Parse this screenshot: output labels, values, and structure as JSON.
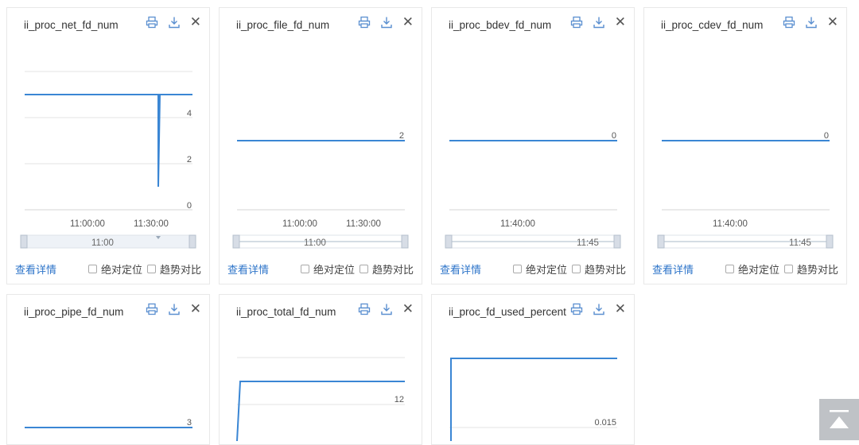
{
  "footer": {
    "detail_label": "查看详情",
    "absolute_position_label": "绝对定位",
    "trend_compare_label": "趋势对比"
  },
  "icons": {
    "print": "print-icon",
    "download": "download-icon",
    "close": "close-icon",
    "scroll_top": "arrow-up-icon"
  },
  "colors": {
    "series": "#3a86d4",
    "grid": "#e3e3e3",
    "link": "#2d74c9"
  },
  "panels": [
    {
      "title": "ii_proc_net_fd_num",
      "chart_data": {
        "type": "line",
        "yticks": [
          "4",
          "2",
          "0"
        ],
        "xticks": [
          "11:00:00",
          "11:30:00"
        ],
        "range_label": "11:00",
        "series": [
          {
            "values": [
              5,
              5,
              5,
              1,
              5,
              5
            ]
          }
        ],
        "note": "constant at 5 with a single dip to about 1 near 11:31"
      }
    },
    {
      "title": "ii_proc_file_fd_num",
      "chart_data": {
        "type": "line",
        "yticks": [
          "2"
        ],
        "xticks": [
          "11:00:00",
          "11:30:00"
        ],
        "range_label": "11:00",
        "series": [
          {
            "values": [
              2,
              2
            ]
          }
        ]
      }
    },
    {
      "title": "ii_proc_bdev_fd_num",
      "chart_data": {
        "type": "line",
        "yticks": [
          "0"
        ],
        "xticks": [
          "11:40:00"
        ],
        "range_label": "11:45",
        "series": [
          {
            "values": [
              0,
              0
            ]
          }
        ]
      }
    },
    {
      "title": "ii_proc_cdev_fd_num",
      "chart_data": {
        "type": "line",
        "yticks": [
          "0"
        ],
        "xticks": [
          "11:40:00"
        ],
        "range_label": "11:45",
        "series": [
          {
            "values": [
              0,
              0
            ]
          }
        ]
      }
    },
    {
      "title": "ii_proc_pipe_fd_num",
      "chart_data": {
        "type": "line",
        "yticks": [
          "3"
        ],
        "series": [
          {
            "values": [
              3,
              3
            ]
          }
        ]
      }
    },
    {
      "title": "ii_proc_total_fd_num",
      "chart_data": {
        "type": "line",
        "yticks": [
          "12"
        ],
        "series": [
          {
            "values": [
              null,
              13,
              13,
              13
            ]
          }
        ]
      }
    },
    {
      "title": "ii_proc_fd_used_percent",
      "chart_data": {
        "type": "line",
        "yticks": [
          "0.015"
        ],
        "series": [
          {
            "values": [
              null,
              0.02,
              0.02,
              0.02
            ]
          }
        ]
      }
    }
  ]
}
